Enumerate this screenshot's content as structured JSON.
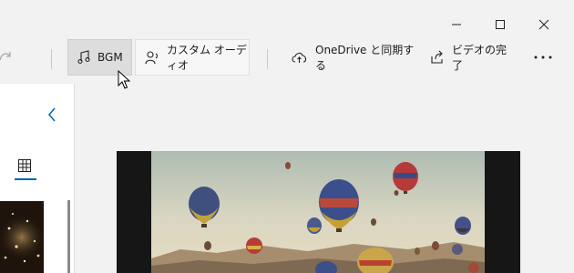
{
  "window": {
    "minimize_icon": "minimize-icon",
    "maximize_icon": "maximize-icon",
    "close_icon": "close-icon"
  },
  "toolbar": {
    "redo_icon": "redo-icon",
    "bgm_label": "BGM",
    "custom_audio_label": "カスタム オーディオ",
    "onedrive_label": "OneDrive と同期する",
    "finish_video_label": "ビデオの完了",
    "more_icon": "more-icon"
  },
  "sidepanel": {
    "collapse_icon": "chevron-left-icon",
    "grid_view_icon": "grid-icon",
    "thumbnail": "night-lights-thumbnail"
  },
  "preview": {
    "image": "hot-air-balloons-photo"
  },
  "colors": {
    "accent": "#0063b1",
    "toolbar_bg": "#f2f2f2",
    "selected_btn_bg": "#dddddd",
    "preview_bg": "#161616"
  }
}
